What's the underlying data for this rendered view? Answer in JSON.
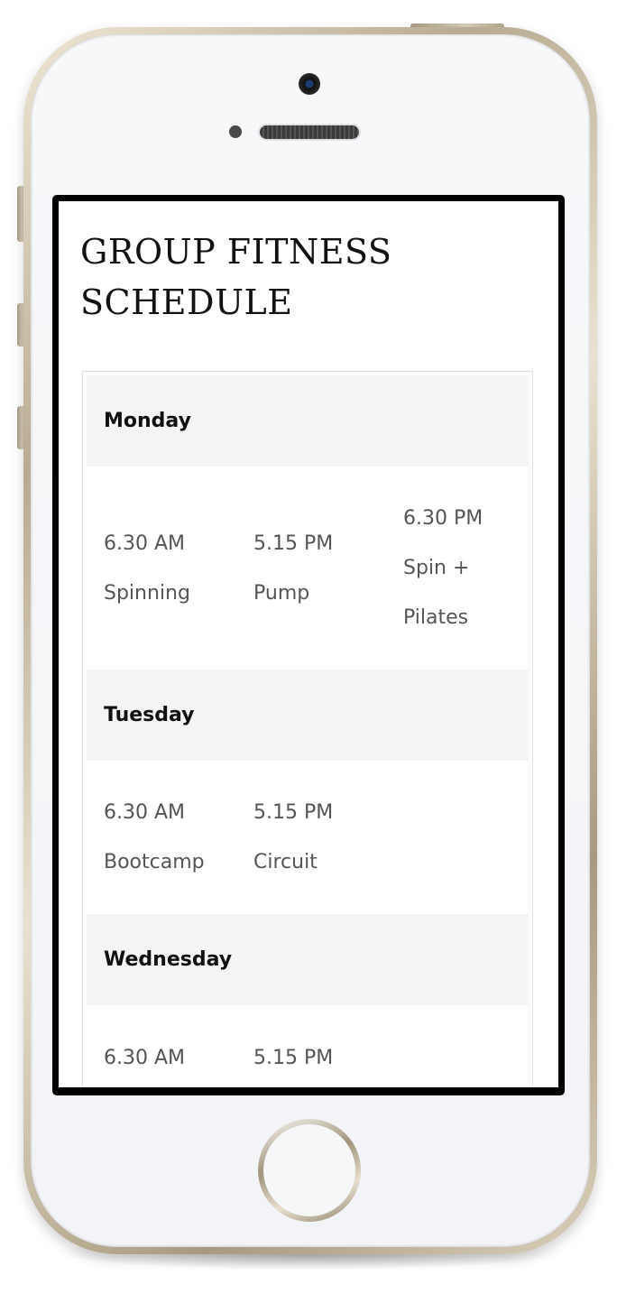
{
  "page": {
    "title": "GROUP FITNESS SCHEDULE"
  },
  "schedule": {
    "days": [
      {
        "name": "Monday",
        "sessions": [
          {
            "time": "6.30 AM",
            "class": "Spinning"
          },
          {
            "time": "5.15 PM",
            "class": "Pump"
          },
          {
            "time": "6.30 PM",
            "class": "Spin + Pilates"
          }
        ]
      },
      {
        "name": "Tuesday",
        "sessions": [
          {
            "time": "6.30 AM",
            "class": "Bootcamp"
          },
          {
            "time": "5.15 PM",
            "class": "Circuit"
          }
        ]
      },
      {
        "name": "Wednesday",
        "sessions": [
          {
            "time": "6.30 AM",
            "class": ""
          },
          {
            "time": "5.15 PM",
            "class": ""
          }
        ]
      }
    ]
  },
  "colors": {
    "day_header_bg": "#f4f4f4",
    "session_text": "#555555",
    "heading_text": "#111111"
  }
}
